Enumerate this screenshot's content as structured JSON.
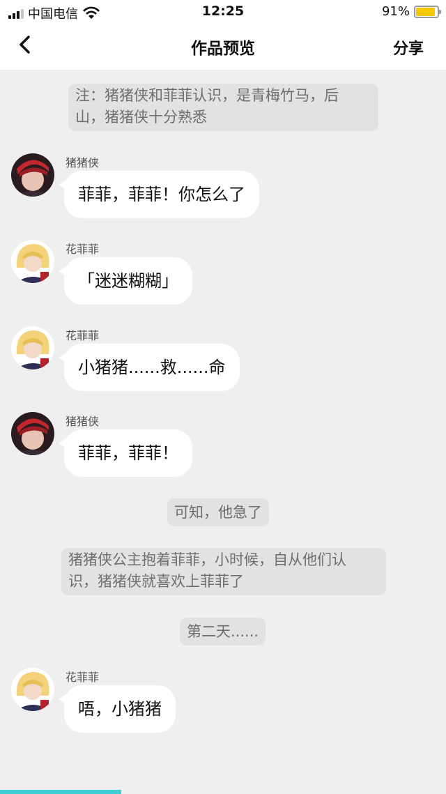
{
  "status_bar": {
    "carrier": "中国电信",
    "time": "12:25",
    "battery_percent_label": "91%",
    "battery_level": 0.91,
    "battery_color": "#f5c800"
  },
  "nav": {
    "back_icon": "chevron-left-icon",
    "title": "作品预览",
    "share_label": "分享"
  },
  "chat": {
    "notes": [
      {
        "text_line1": "注：猪猪侠和菲菲认识，是青梅竹马，后",
        "text_line2": "山，猪猪侠十分熟悉"
      },
      {
        "text": "可知，他急了"
      },
      {
        "text_line1": "猪猪侠公主抱着菲菲，小时候，自从他们认",
        "text_line2": "识，猪猪侠就喜欢上菲菲了"
      },
      {
        "text": "第二天......"
      }
    ],
    "messages": [
      {
        "sender": "猪猪侠",
        "text": "菲菲，菲菲！你怎么了",
        "avatar": "pig-hero-avatar"
      },
      {
        "sender": "花菲菲",
        "text": "「迷迷糊糊」",
        "avatar": "feifei-avatar"
      },
      {
        "sender": "花菲菲",
        "text": "小猪猪......救......命",
        "avatar": "feifei-avatar"
      },
      {
        "sender": "猪猪侠",
        "text": "菲菲，菲菲！",
        "avatar": "pig-hero-avatar"
      },
      {
        "sender": "花菲菲",
        "text": "唔，小猪猪",
        "avatar": "feifei-avatar"
      }
    ]
  },
  "progress": {
    "value": 0.27,
    "color": "#3ecfd6"
  }
}
